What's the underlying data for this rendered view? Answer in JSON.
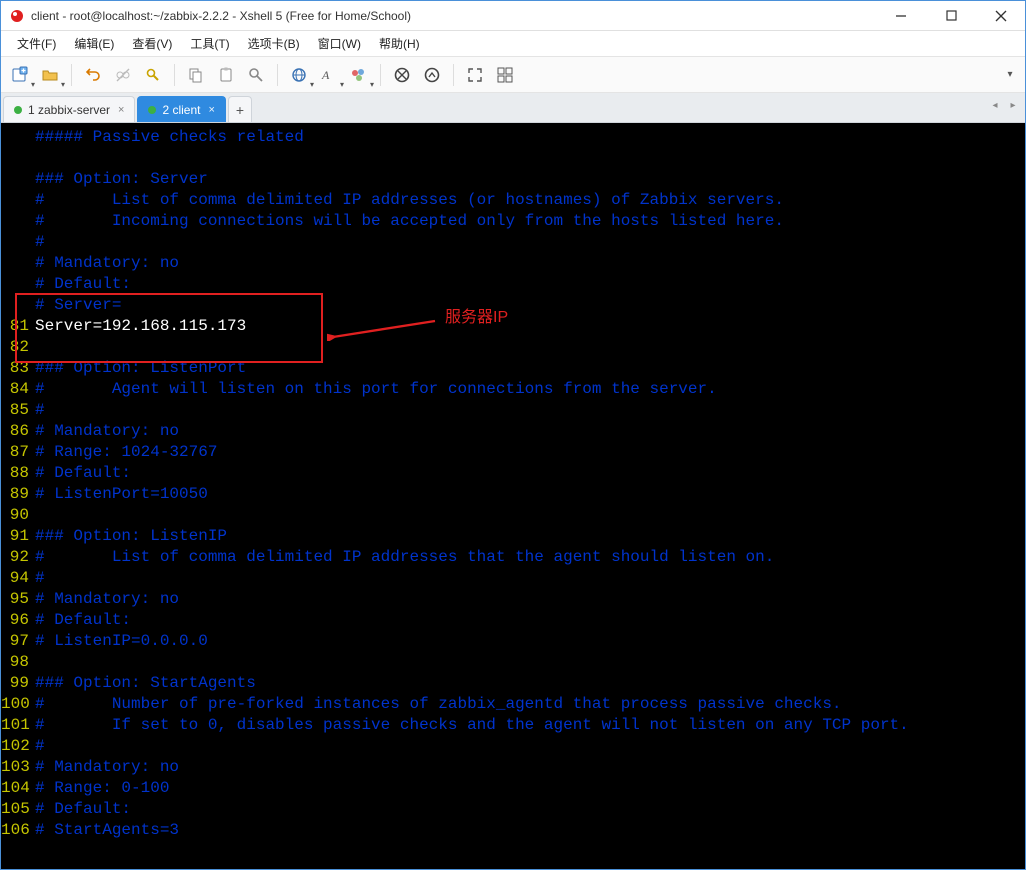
{
  "window": {
    "title": "client - root@localhost:~/zabbix-2.2.2 - Xshell 5 (Free for Home/School)"
  },
  "menu": {
    "file": "文件(F)",
    "edit": "编辑(E)",
    "view": "查看(V)",
    "tools": "工具(T)",
    "tabs": "选项卡(B)",
    "window": "窗口(W)",
    "help": "帮助(H)"
  },
  "toolbar_icons": {
    "new": "new-file-icon",
    "open": "open-folder-icon",
    "connect": "connect-icon",
    "disconnect": "disconnect-icon",
    "properties": "key-icon",
    "copy": "copy-icon",
    "paste": "paste-icon",
    "find": "find-icon",
    "globe": "globe-icon",
    "font": "font-icon",
    "palette": "palette-icon",
    "xagent": "xagent-icon",
    "xftp": "xftp-icon",
    "fullscreen": "fullscreen-icon",
    "tile": "tile-icon"
  },
  "tabs": [
    {
      "label": "1 zabbix-server",
      "active": false
    },
    {
      "label": "2 client",
      "active": true
    }
  ],
  "annotation": {
    "label": "服务器IP"
  },
  "config_lines": [
    {
      "num": "",
      "text": "##### Passive checks related",
      "style": "comment"
    },
    {
      "num": "",
      "text": "",
      "style": "comment"
    },
    {
      "num": "",
      "text": "### Option: Server",
      "style": "comment"
    },
    {
      "num": "",
      "text": "#       List of comma delimited IP addresses (or hostnames) of Zabbix servers.",
      "style": "comment"
    },
    {
      "num": "",
      "text": "#       Incoming connections will be accepted only from the hosts listed here.",
      "style": "comment"
    },
    {
      "num": "",
      "text": "#",
      "style": "comment"
    },
    {
      "num": "",
      "text": "# Mandatory: no",
      "style": "comment"
    },
    {
      "num": "",
      "text": "# Default:",
      "style": "comment"
    },
    {
      "num": "",
      "text": "# Server=",
      "style": "comment"
    },
    {
      "num": "81",
      "text": "Server=192.168.115.173",
      "style": "hl"
    },
    {
      "num": "82",
      "text": "",
      "style": "plain"
    },
    {
      "num": "83",
      "text": "### Option: ListenPort",
      "style": "comment"
    },
    {
      "num": "84",
      "text": "#       Agent will listen on this port for connections from the server.",
      "style": "comment"
    },
    {
      "num": "85",
      "text": "#",
      "style": "comment"
    },
    {
      "num": "86",
      "text": "# Mandatory: no",
      "style": "comment"
    },
    {
      "num": "87",
      "text": "# Range: 1024-32767",
      "style": "comment"
    },
    {
      "num": "88",
      "text": "# Default:",
      "style": "comment"
    },
    {
      "num": "89",
      "text": "# ListenPort=10050",
      "style": "comment"
    },
    {
      "num": "90",
      "text": "",
      "style": "comment"
    },
    {
      "num": "91",
      "text": "### Option: ListenIP",
      "style": "comment"
    },
    {
      "num": "92",
      "text": "#       List of comma delimited IP addresses that the agent should listen on.",
      "style": "comment"
    },
    {
      "num": "94",
      "text": "#",
      "style": "comment"
    },
    {
      "num": "95",
      "text": "# Mandatory: no",
      "style": "comment"
    },
    {
      "num": "96",
      "text": "# Default:",
      "style": "comment"
    },
    {
      "num": "97",
      "text": "# ListenIP=0.0.0.0",
      "style": "comment"
    },
    {
      "num": "98",
      "text": "",
      "style": "comment"
    },
    {
      "num": "99",
      "text": "### Option: StartAgents",
      "style": "comment"
    },
    {
      "num": "100",
      "text": "#       Number of pre-forked instances of zabbix_agentd that process passive checks.",
      "style": "comment"
    },
    {
      "num": "101",
      "text": "#       If set to 0, disables passive checks and the agent will not listen on any TCP port.",
      "style": "comment"
    },
    {
      "num": "102",
      "text": "#",
      "style": "comment"
    },
    {
      "num": "103",
      "text": "# Mandatory: no",
      "style": "comment"
    },
    {
      "num": "104",
      "text": "# Range: 0-100",
      "style": "comment"
    },
    {
      "num": "105",
      "text": "# Default:",
      "style": "comment"
    },
    {
      "num": "106",
      "text": "# StartAgents=3",
      "style": "comment"
    }
  ]
}
